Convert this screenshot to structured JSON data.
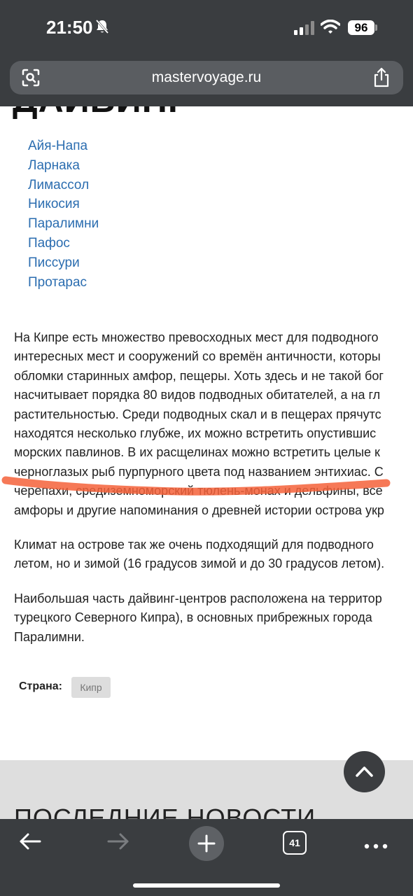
{
  "status": {
    "time": "21:50",
    "battery": "96"
  },
  "browser": {
    "url": "mastervoyage.ru",
    "tab_count": "41"
  },
  "page": {
    "heading": "ДАЙВИНГ",
    "cities": [
      "Айя-Напа",
      "Ларнака",
      "Лимассол",
      "Никосия",
      "Паралимни",
      "Пафос",
      "Писсури",
      "Протарас"
    ],
    "paragraph1": [
      "На Кипре есть множество превосходных мест для подводного",
      "интересных мест и сооружений со времён античности, которы",
      "обломки старинных амфор, пещеры. Хоть здесь и не такой бог",
      "насчитывает порядка 80 видов подводных обитателей, а на гл",
      "растительностью. Среди подводных скал и в пещерах прячутс",
      "находятся несколько глубже, их можно встретить опустившис",
      "морских павлинов. В их расщелинах можно встретить целые к",
      "черноглазых рыб пурпурного цвета под названием энтихиас. С",
      "черепахи, средиземноморский тюлень-монах и дельфины, все",
      "амфоры и другие напоминания о древней истории острова укр"
    ],
    "paragraph2": [
      "Климат на острове так же очень подходящий для подводного",
      "летом, но и зимой (16 градусов зимой и до 30 градусов летом)."
    ],
    "paragraph3": [
      "Наибольшая часть дайвинг-центров расположена на территор",
      "турецкого Северного Кипра), в основных прибрежных города",
      "Паралимни."
    ],
    "country_label": "Страна:",
    "country_tag": "Кипр",
    "news_heading": "ПОСЛЕДНИЕ НОВОСТИ"
  },
  "colors": {
    "link": "#2b6db0",
    "highlight": "#f4623a",
    "chrome": "#3a3d40"
  }
}
